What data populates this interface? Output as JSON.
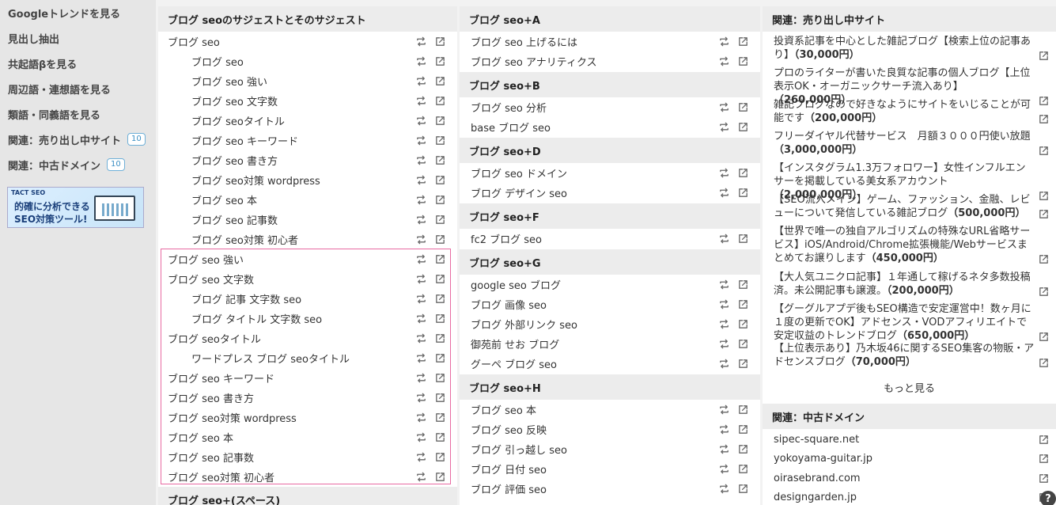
{
  "sidebar": {
    "items": [
      {
        "label": "Googleトレンドを見る",
        "badge": ""
      },
      {
        "label": "見出し抽出",
        "badge": ""
      },
      {
        "label": "共起語βを見る",
        "badge": ""
      },
      {
        "label": "周辺語・連想語を見る",
        "badge": ""
      },
      {
        "label": "類語・同義語を見る",
        "badge": ""
      },
      {
        "label": "関連：売り出し中サイト",
        "badge": "10"
      },
      {
        "label": "関連：中古ドメイン",
        "badge": "10"
      }
    ],
    "banner": {
      "brand": "TACT SEO",
      "line1": "的確に分析できる",
      "line2": "SEO対策ツール!"
    }
  },
  "col1": {
    "header": "ブログ seoのサジェストとそのサジェスト",
    "rows": [
      {
        "text": "ブログ seo",
        "indent": 0
      },
      {
        "text": "ブログ seo",
        "indent": 1
      },
      {
        "text": "ブログ seo 強い",
        "indent": 1
      },
      {
        "text": "ブログ seo 文字数",
        "indent": 1
      },
      {
        "text": "ブログ seoタイトル",
        "indent": 1
      },
      {
        "text": "ブログ seo キーワード",
        "indent": 1
      },
      {
        "text": "ブログ seo 書き方",
        "indent": 1
      },
      {
        "text": "ブログ seo対策 wordpress",
        "indent": 1
      },
      {
        "text": "ブログ seo 本",
        "indent": 1
      },
      {
        "text": "ブログ seo 記事数",
        "indent": 1
      },
      {
        "text": "ブログ seo対策 初心者",
        "indent": 1
      },
      {
        "text": "ブログ seo 強い",
        "indent": 0
      },
      {
        "text": "ブログ seo 文字数",
        "indent": 0
      },
      {
        "text": "ブログ 記事 文字数 seo",
        "indent": 1
      },
      {
        "text": "ブログ タイトル 文字数 seo",
        "indent": 1
      },
      {
        "text": "ブログ seoタイトル",
        "indent": 0
      },
      {
        "text": "ワードプレス ブログ seoタイトル",
        "indent": 1
      },
      {
        "text": "ブログ seo キーワード",
        "indent": 0
      },
      {
        "text": "ブログ seo 書き方",
        "indent": 0
      },
      {
        "text": "ブログ seo対策 wordpress",
        "indent": 0
      },
      {
        "text": "ブログ seo 本",
        "indent": 0
      },
      {
        "text": "ブログ seo 記事数",
        "indent": 0
      },
      {
        "text": "ブログ seo対策 初心者",
        "indent": 0
      }
    ],
    "footer_header": "ブログ seo+(スペース)"
  },
  "col2": {
    "sections": [
      {
        "header": "ブログ seo+A",
        "rows": [
          "ブログ seo 上げるには",
          "ブログ seo アナリティクス"
        ]
      },
      {
        "header": "ブログ seo+B",
        "rows": [
          "ブログ seo 分析",
          "base ブログ seo"
        ]
      },
      {
        "header": "ブログ seo+D",
        "rows": [
          "ブログ seo ドメイン",
          "ブログ デザイン seo"
        ]
      },
      {
        "header": "ブログ seo+F",
        "rows": [
          "fc2 ブログ seo"
        ]
      },
      {
        "header": "ブログ seo+G",
        "rows": [
          "google seo ブログ",
          "ブログ 画像 seo",
          "ブログ 外部リンク seo",
          "御苑前 せお ブログ",
          "グーペ ブログ seo"
        ]
      },
      {
        "header": "ブログ seo+H",
        "rows": [
          "ブログ seo 本",
          "ブログ seo 反映",
          "ブログ 引っ越し seo",
          "ブログ 日付 seo",
          "ブログ 評価 seo"
        ]
      }
    ]
  },
  "col3": {
    "sale_header": "関連：売り出し中サイト",
    "sales": [
      {
        "text": "投資系記事を中心とした雑記ブログ【検索上位の記事あり】",
        "price": "（30,000円）"
      },
      {
        "text": "プロのライターが書いた良質な記事の個人ブログ【上位表示OK・オーガニックサーチ流入あり】",
        "price": "（260,000円）"
      },
      {
        "text": "雑記ブログなので好きなようにサイトをいじることが可能です",
        "price": "（200,000円）"
      },
      {
        "text": "フリーダイヤル代替サービス　月額３０００円使い放題",
        "price": "（3,000,000円）"
      },
      {
        "text": "【インスタグラム1.3万フォロワー】女性インフルエンサーを掲載している美女系アカウント",
        "price": "（2,000,000円）"
      },
      {
        "text": "【SEO流入メイン】ゲーム、ファッション、金融、レビューについて発信している雑記ブログ",
        "price": "（500,000円）"
      },
      {
        "text": "【世界で唯一の独自アルゴリズムの特殊なURL省略サービス】iOS/Android/Chrome拡張機能/Webサービスまとめてお譲りします",
        "price": "（450,000円）"
      },
      {
        "text": "【大人気ユニクロ記事】１年通して稼げるネタ多数投稿済。未公開記事も譲渡。",
        "price": "（200,000円）"
      },
      {
        "text": "【グーグルアプデ後もSEO構造で安定運営中！数ヶ月に１度の更新でOK】アドセンス・VODアフィリエイトで安定収益のトレンドブログ",
        "price": "（650,000円）"
      },
      {
        "text": "【上位表示あり】乃木坂46に関するSEO集客の物販・アドセンスブログ",
        "price": "（70,000円）"
      }
    ],
    "more_label": "もっと見る",
    "domain_header": "関連：中古ドメイン",
    "domains": [
      "sipec-square.net",
      "yokoyama-guitar.jp",
      "oirasebrand.com",
      "designgarden.jp"
    ]
  },
  "help_label": "?"
}
